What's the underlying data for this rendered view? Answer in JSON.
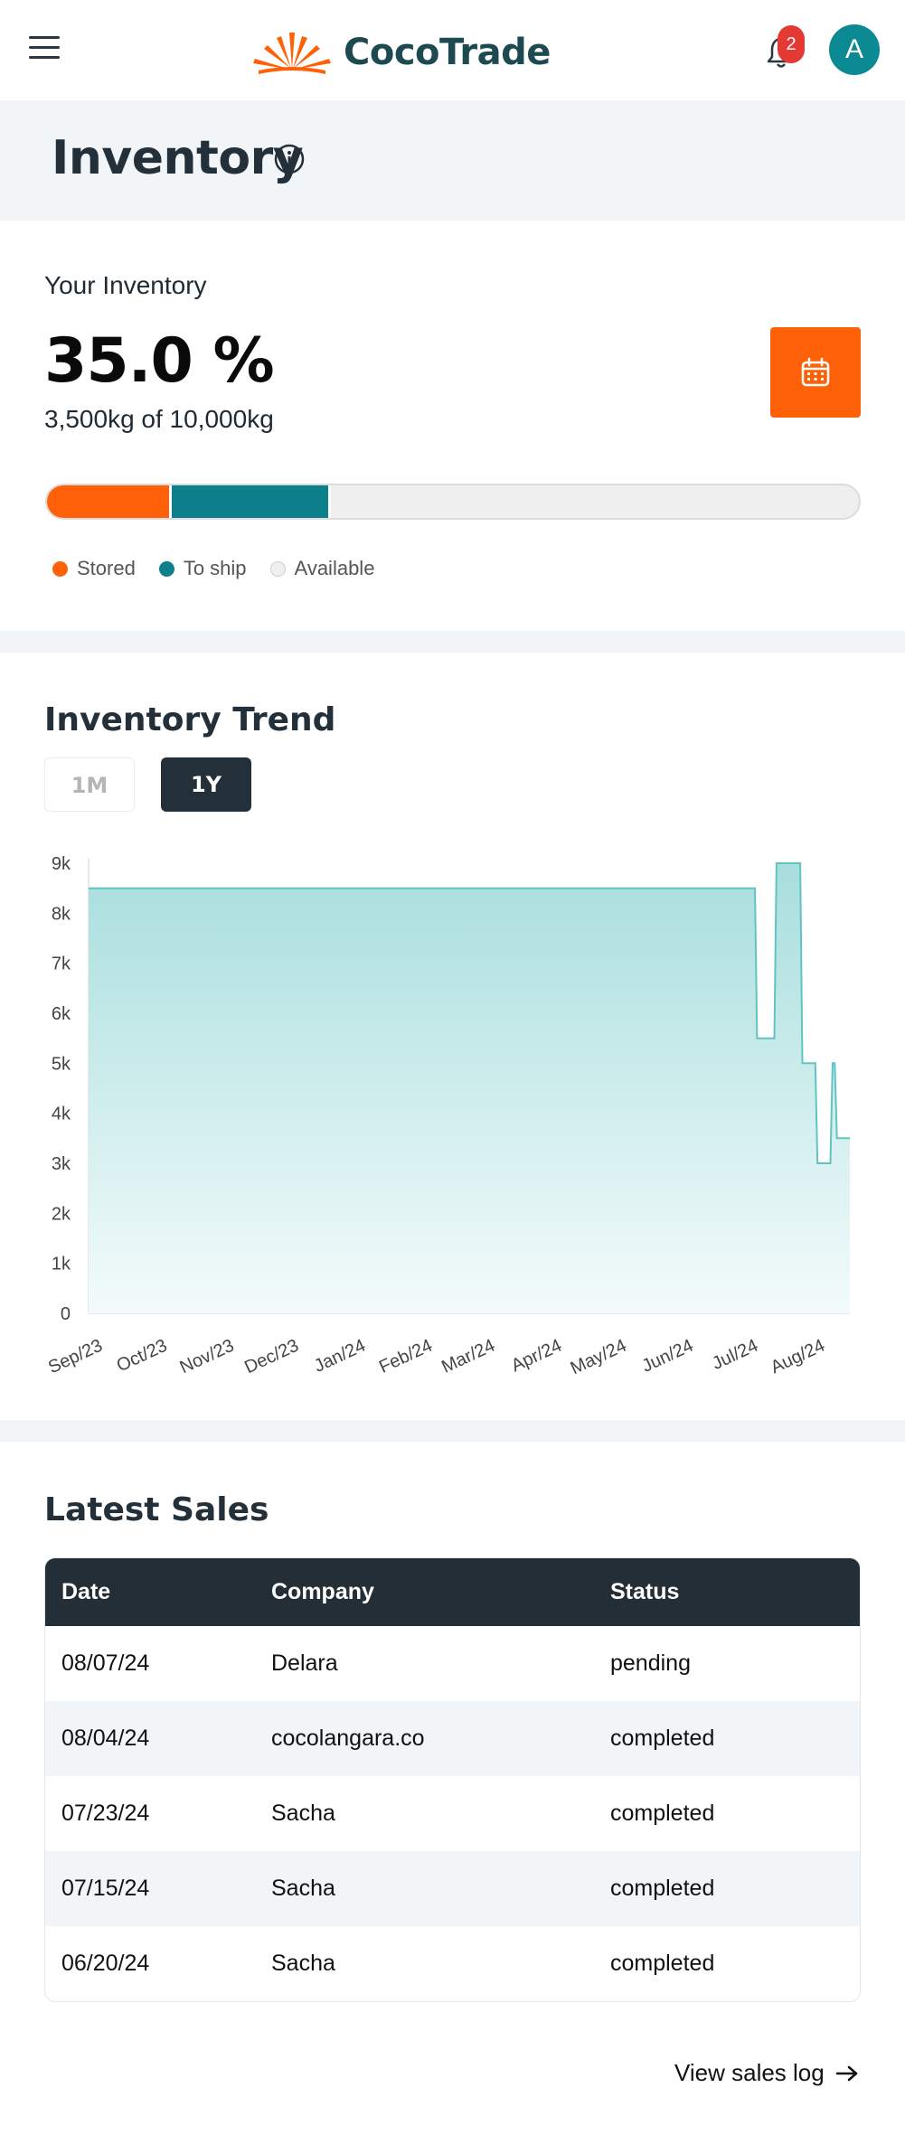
{
  "header": {
    "brand": "CocoTrade",
    "notification_count": "2",
    "avatar_initial": "A"
  },
  "page": {
    "title": "Inventory"
  },
  "inventory": {
    "label": "Your Inventory",
    "percent_text": "35.0 %",
    "amount_text": "3,500kg of 10,000kg",
    "stored_fraction": 0.15,
    "to_ship_fraction": 0.2,
    "legend": [
      {
        "label": "Stored",
        "color": "#ff6108"
      },
      {
        "label": "To ship",
        "color": "#0c7f8a"
      },
      {
        "label": "Available",
        "color": "#efefef"
      }
    ]
  },
  "trend": {
    "title": "Inventory Trend",
    "ranges": [
      "1M",
      "1Y"
    ],
    "selected_range": "1Y"
  },
  "chart_data": {
    "type": "area",
    "title": "Inventory Trend",
    "xlabel": "",
    "ylabel": "",
    "ylim": [
      0,
      9000
    ],
    "y_ticks": [
      "0",
      "1k",
      "2k",
      "3k",
      "4k",
      "5k",
      "6k",
      "7k",
      "8k",
      "9k"
    ],
    "x_ticks": [
      "Sep/23",
      "Oct/23",
      "Nov/23",
      "Dec/23",
      "Jan/24",
      "Feb/24",
      "Mar/24",
      "Apr/24",
      "May/24",
      "Jun/24",
      "Jul/24",
      "Aug/24"
    ],
    "series": [
      {
        "points": [
          [
            "2023-08-25",
            8500
          ],
          [
            "2024-06-29",
            8500
          ],
          [
            "2024-06-30",
            5500
          ],
          [
            "2024-07-08",
            5500
          ],
          [
            "2024-07-09",
            9000
          ],
          [
            "2024-07-20",
            9000
          ],
          [
            "2024-07-21",
            5000
          ],
          [
            "2024-07-27",
            5000
          ],
          [
            "2024-07-28",
            3000
          ],
          [
            "2024-08-03",
            3000
          ],
          [
            "2024-08-04",
            5000
          ],
          [
            "2024-08-05",
            5000
          ],
          [
            "2024-08-06",
            3500
          ],
          [
            "2024-08-12",
            3500
          ]
        ]
      }
    ],
    "colors": {
      "line": "#62c3c3",
      "fill_top": "#a8dedd",
      "fill_bottom": "#f3fbfb"
    },
    "grid": false
  },
  "sales": {
    "title": "Latest Sales",
    "columns": [
      "Date",
      "Company",
      "Status"
    ],
    "rows": [
      [
        "08/07/24",
        "Delara",
        "pending"
      ],
      [
        "08/04/24",
        "cocolangara.co",
        "completed"
      ],
      [
        "07/23/24",
        "Sacha",
        "completed"
      ],
      [
        "07/15/24",
        "Sacha",
        "completed"
      ],
      [
        "06/20/24",
        "Sacha",
        "completed"
      ]
    ],
    "link": "View sales log"
  }
}
